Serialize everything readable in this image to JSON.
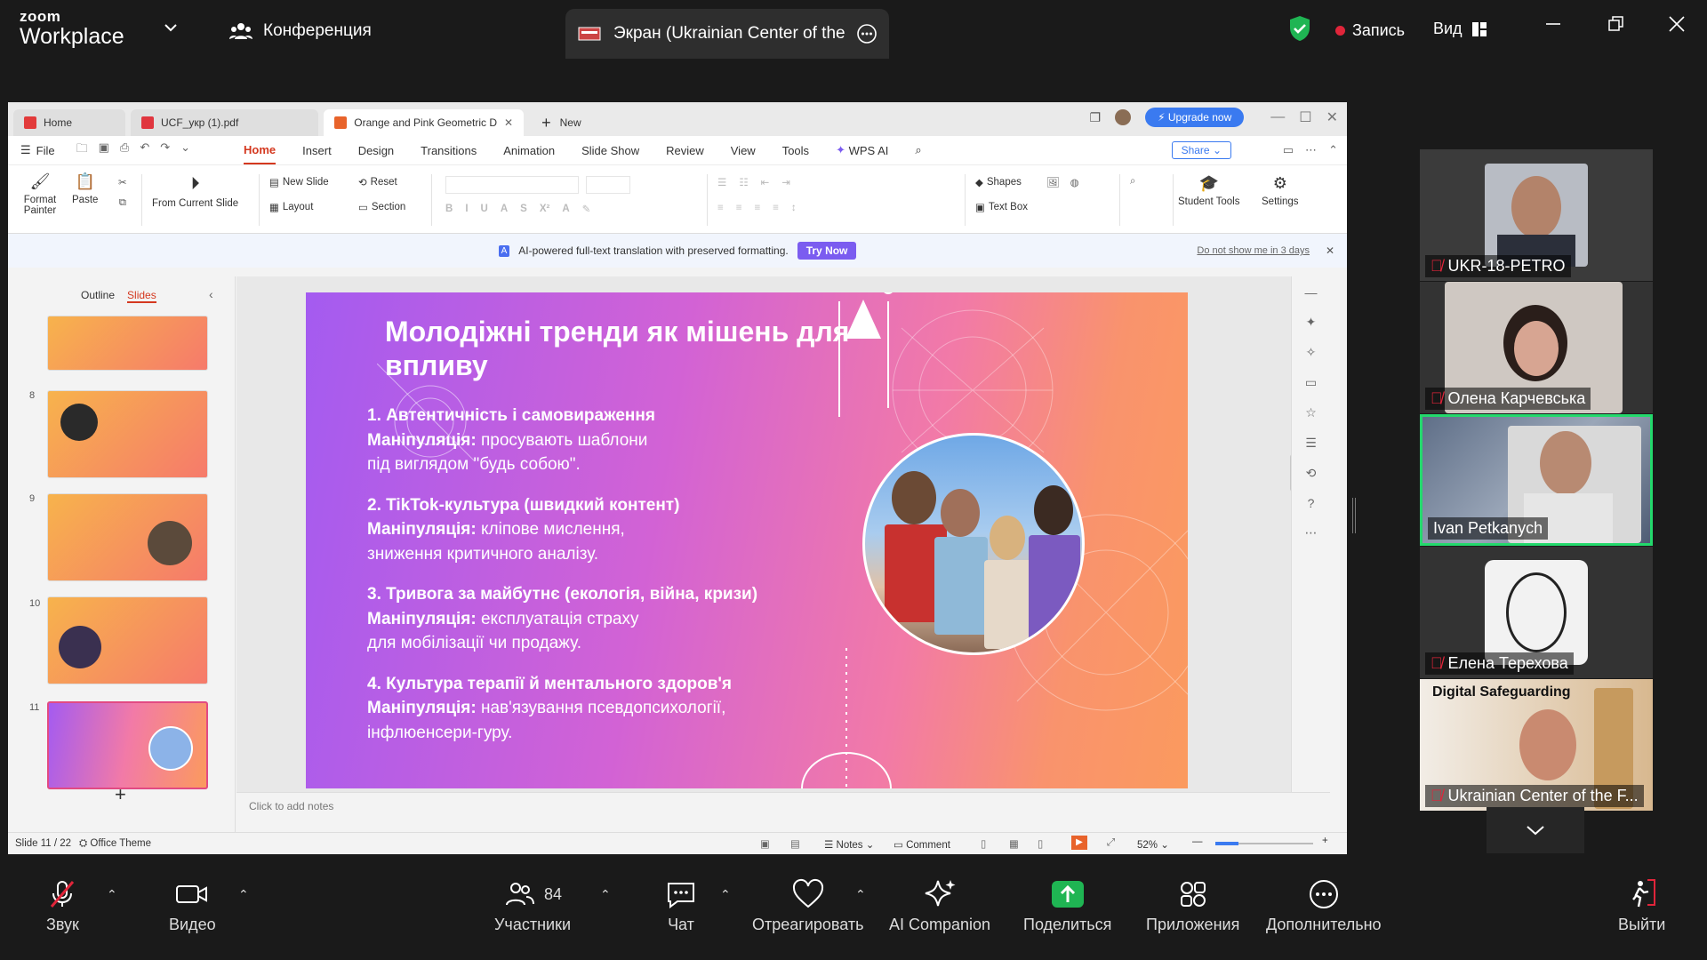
{
  "zoom": {
    "logo_top": "zoom",
    "logo_bottom": "Workplace",
    "meeting_title": "Конференция",
    "share_tab_title": "Экран (Ukrainian Center of the Fu",
    "record_label": "Запись",
    "view_label": "Вид",
    "colors": {
      "record": "#e0253a",
      "shield": "#1fb553",
      "active_speaker": "#23d96c"
    }
  },
  "wps": {
    "tabs": [
      {
        "label": "Home"
      },
      {
        "label": "UCF_укр (1).pdf"
      },
      {
        "label": "Orange and Pink Geometric D"
      }
    ],
    "new_tab_label": "New",
    "upgrade_label": "Upgrade now",
    "file_label": "File",
    "menu": [
      "Home",
      "Insert",
      "Design",
      "Transitions",
      "Animation",
      "Slide Show",
      "Review",
      "View",
      "Tools"
    ],
    "wps_ai_label": "WPS AI",
    "share_label": "Share",
    "ribbon": {
      "format_painter": "Format Painter",
      "paste": "Paste",
      "from_current_slide": "From Current Slide",
      "new_slide": "New Slide",
      "reset": "Reset",
      "layout": "Layout",
      "section": "Section",
      "shapes": "Shapes",
      "text_box": "Text Box",
      "student_tools": "Student Tools",
      "settings": "Settings"
    },
    "notification": {
      "text": "AI-powered full-text translation with preserved formatting.",
      "try_now": "Try Now",
      "dismiss": "Do not show me in 3 days"
    },
    "panel": {
      "outline_tab": "Outline",
      "slides_tab": "Slides",
      "thumb_numbers": [
        "8",
        "9",
        "10",
        "11"
      ]
    },
    "slide": {
      "title": "Молодіжні тренди як мішень для впливу",
      "points": [
        {
          "heading": "1. Автентичність і самовираження",
          "label": "Маніпуляція:",
          "text": " просувають шаблони",
          "text2": "під виглядом \"будь собою\"."
        },
        {
          "heading": "2. TikTok-культура (швидкий контент)",
          "label": "Маніпуляція:",
          "text": " кліпове мислення,",
          "text2": "зниження критичного аналізу."
        },
        {
          "heading": "3. Тривога за майбутнє (екологія, війна, кризи)",
          "label": "Маніпуляція:",
          "text": " експлуатація страху",
          "text2": "для мобілізації чи продажу."
        },
        {
          "heading": "4. Культура терапії й ментального здоров'я",
          "label": "Маніпуляція:",
          "text": " нав'язування псевдопсихології,",
          "text2": " інфлюенсери-гуру."
        }
      ]
    },
    "notes_placeholder": "Click to add notes",
    "status": {
      "slide_counter": "Slide 11 / 22",
      "theme": "Office Theme",
      "notes": "Notes",
      "comment": "Comment",
      "zoom_level": "52%"
    }
  },
  "participants": [
    {
      "name": "UKR-18-PETRO",
      "muted": true
    },
    {
      "name": "Олена Карчевська",
      "muted": true
    },
    {
      "name": "Ivan Petkanych",
      "muted": false,
      "active": true
    },
    {
      "name": "Елена Терехова",
      "muted": true
    },
    {
      "name": "Ukrainian Center of the F...",
      "muted": true,
      "overlay_title": "Digital Safeguarding"
    }
  ],
  "toolbar": {
    "audio": "Звук",
    "video": "Видео",
    "participants": "Участники",
    "participants_count": "84",
    "chat": "Чат",
    "react": "Отреагировать",
    "ai_companion": "AI Companion",
    "share": "Поделиться",
    "apps": "Приложения",
    "more": "Дополнительно",
    "leave": "Выйти"
  }
}
